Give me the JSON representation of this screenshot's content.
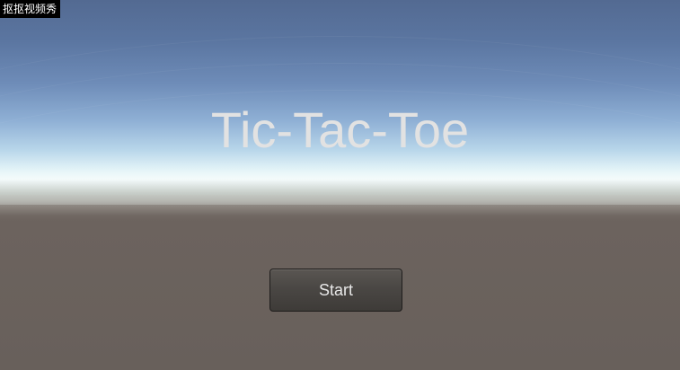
{
  "watermark": {
    "text": "抠抠视频秀"
  },
  "menu": {
    "title": "Tic-Tac-Toe",
    "start_label": "Start"
  },
  "colors": {
    "sky_top": "#536a92",
    "horizon": "#f4fbfb",
    "ground": "#68605b",
    "title_text": "#e2e2e2",
    "button_bg": "#4a4744",
    "button_text": "#e8e8e8"
  }
}
